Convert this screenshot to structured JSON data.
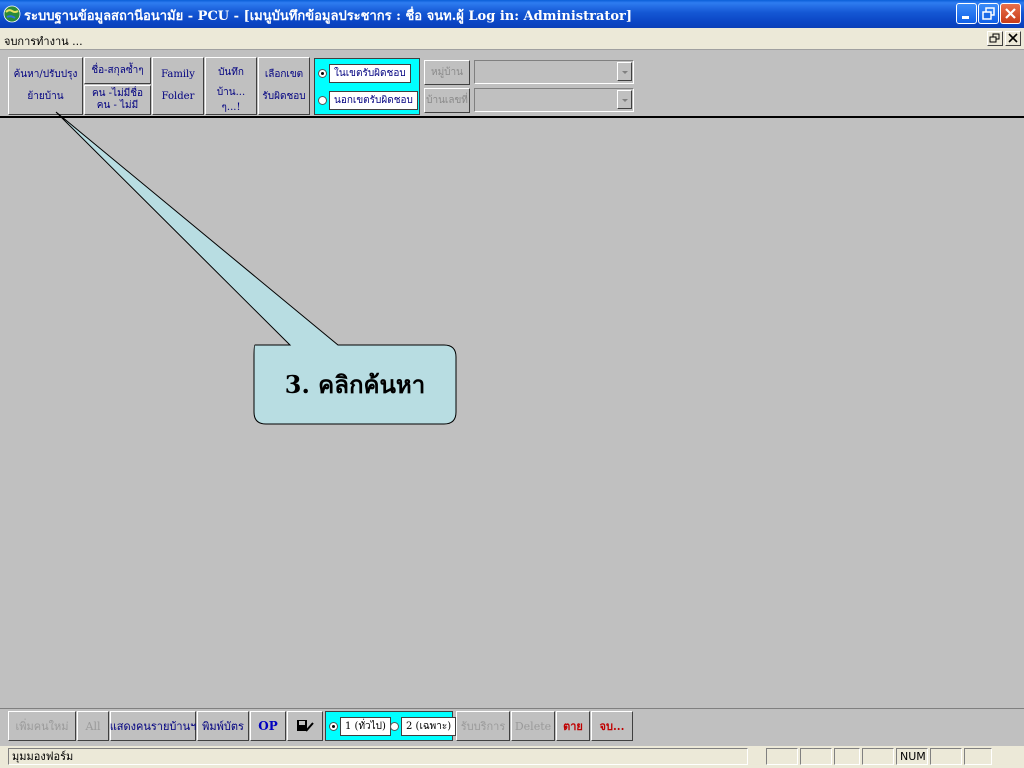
{
  "window": {
    "title": "ระบบฐานข้อมูลสถานีอนามัย - PCU - [เมนูบันทึกข้อมูลประชากร : ชื่อ จนท.ผู้ Log in: Administrator]"
  },
  "menubar": {
    "item": "จบการทำงาน ..."
  },
  "toolbar": {
    "search_line1": "ค้นหา/ปรับปรุง",
    "search_line2": "ย้ายบ้าน",
    "name_surname": "ชื่อ-สกุลซ้ำๆ",
    "no_name_line1": "คน -ไม่มีชื่อ",
    "no_name_line2": "คน - ไม่มี",
    "family_line1": "Family",
    "family_line2": "Folder",
    "record_line1": "บันทึก",
    "record_line2": "บ้าน...",
    "record_line3": "ๆ...!",
    "select_line1": "เลือกเขต",
    "select_line2": "รับผิดชอบ",
    "radio_in": "ในเขตรับผิดชอบ",
    "radio_out": "นอกเขตรับผิดชอบ",
    "village_label": "หมู่บ้าน",
    "house_label": "บ้านเลขที่",
    "village_value": "",
    "house_value": ""
  },
  "callout": {
    "text": "3. คลิกค้นหา"
  },
  "bottombar": {
    "add_new": "เพิ่มคนใหม่",
    "all": "All",
    "show_list": "แสดงคนรายบ้านฯ",
    "print_card": "พิมพ์บัตร",
    "op": "OP",
    "radio_general": "1 (ทั่วไป)",
    "radio_specific": "2 (เฉพาะ)",
    "service": "รับบริการ",
    "delete": "Delete",
    "dead": "ตาย",
    "end": "จบ..."
  },
  "statusbar": {
    "text": "มุมมองฟอร์ม",
    "num": "NUM"
  }
}
